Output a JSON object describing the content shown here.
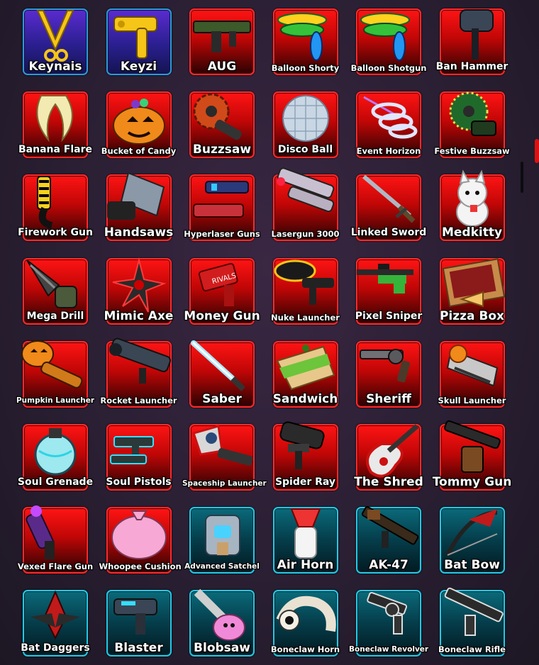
{
  "inventory": {
    "items": [
      {
        "name": "Keynais",
        "rarity": "blue",
        "icon": "golden-crossed-blades-icon"
      },
      {
        "name": "Keyzi",
        "rarity": "blue",
        "icon": "golden-key-gun-icon"
      },
      {
        "name": "AUG",
        "rarity": "red",
        "icon": "green-rifle-icon"
      },
      {
        "name": "Balloon Shorty",
        "rarity": "red",
        "icon": "balloon-shotgun-icon"
      },
      {
        "name": "Balloon Shotgun",
        "rarity": "red",
        "icon": "balloon-shotgun-icon"
      },
      {
        "name": "Ban Hammer",
        "rarity": "red",
        "icon": "hammer-icon"
      },
      {
        "name": "Banana Flare",
        "rarity": "red",
        "icon": "banana-icon"
      },
      {
        "name": "Bucket of Candy",
        "rarity": "red",
        "icon": "pumpkin-bucket-icon"
      },
      {
        "name": "Buzzsaw",
        "rarity": "red",
        "icon": "buzzsaw-icon"
      },
      {
        "name": "Disco Ball",
        "rarity": "red",
        "icon": "disco-ball-icon"
      },
      {
        "name": "Event Horizon",
        "rarity": "red",
        "icon": "spiral-gun-icon"
      },
      {
        "name": "Festive Buzzsaw",
        "rarity": "red",
        "icon": "festive-buzzsaw-icon"
      },
      {
        "name": "Firework Gun",
        "rarity": "red",
        "icon": "firework-gun-icon"
      },
      {
        "name": "Handsaws",
        "rarity": "red",
        "icon": "handsaw-icon"
      },
      {
        "name": "Hyperlaser Guns",
        "rarity": "red",
        "icon": "laser-pistols-icon"
      },
      {
        "name": "Lasergun 3000",
        "rarity": "red",
        "icon": "lasergun-icon"
      },
      {
        "name": "Linked Sword",
        "rarity": "red",
        "icon": "sword-icon"
      },
      {
        "name": "Medkitty",
        "rarity": "red",
        "icon": "cat-icon"
      },
      {
        "name": "Mega Drill",
        "rarity": "red",
        "icon": "drill-icon"
      },
      {
        "name": "Mimic Axe",
        "rarity": "red",
        "icon": "shuriken-axe-icon"
      },
      {
        "name": "Money Gun",
        "rarity": "red",
        "icon": "money-gun-icon"
      },
      {
        "name": "Nuke Launcher",
        "rarity": "red",
        "icon": "nuke-launcher-icon"
      },
      {
        "name": "Pixel Sniper",
        "rarity": "red",
        "icon": "pixel-sniper-icon"
      },
      {
        "name": "Pizza Box",
        "rarity": "red",
        "icon": "pizza-box-icon"
      },
      {
        "name": "Pumpkin Launcher",
        "rarity": "red",
        "icon": "pumpkin-launcher-icon"
      },
      {
        "name": "Rocket Launcher",
        "rarity": "red",
        "icon": "rocket-launcher-icon"
      },
      {
        "name": "Saber",
        "rarity": "red",
        "icon": "light-saber-icon"
      },
      {
        "name": "Sandwich",
        "rarity": "red",
        "icon": "sandwich-icon"
      },
      {
        "name": "Sheriff",
        "rarity": "red",
        "icon": "revolver-icon"
      },
      {
        "name": "Skull Launcher",
        "rarity": "red",
        "icon": "skull-launcher-icon"
      },
      {
        "name": "Soul Grenade",
        "rarity": "red",
        "icon": "grenade-icon"
      },
      {
        "name": "Soul Pistols",
        "rarity": "red",
        "icon": "soul-pistols-icon"
      },
      {
        "name": "Spaceship Launcher",
        "rarity": "red",
        "icon": "spaceship-launcher-icon"
      },
      {
        "name": "Spider Ray",
        "rarity": "red",
        "icon": "spider-ray-icon"
      },
      {
        "name": "The Shred",
        "rarity": "red",
        "icon": "guitar-icon"
      },
      {
        "name": "Tommy Gun",
        "rarity": "red",
        "icon": "tommy-gun-icon"
      },
      {
        "name": "Vexed Flare Gun",
        "rarity": "red",
        "icon": "flare-gun-icon"
      },
      {
        "name": "Whoopee Cushion",
        "rarity": "red",
        "icon": "whoopee-cushion-icon"
      },
      {
        "name": "Advanced Satchel",
        "rarity": "cyan",
        "icon": "satchel-icon"
      },
      {
        "name": "Air Horn",
        "rarity": "cyan",
        "icon": "air-horn-icon"
      },
      {
        "name": "AK-47",
        "rarity": "cyan",
        "icon": "ak47-icon"
      },
      {
        "name": "Bat Bow",
        "rarity": "cyan",
        "icon": "bat-bow-icon"
      },
      {
        "name": "Bat Daggers",
        "rarity": "cyan",
        "icon": "bat-daggers-icon"
      },
      {
        "name": "Blaster",
        "rarity": "cyan",
        "icon": "blaster-icon"
      },
      {
        "name": "Blobsaw",
        "rarity": "cyan",
        "icon": "blobsaw-icon"
      },
      {
        "name": "Boneclaw Horn",
        "rarity": "cyan",
        "icon": "bone-horn-icon"
      },
      {
        "name": "Boneclaw Revolver",
        "rarity": "cyan",
        "icon": "bone-revolver-icon"
      },
      {
        "name": "Boneclaw Rifle",
        "rarity": "cyan",
        "icon": "bone-rifle-icon"
      }
    ]
  },
  "colors": {
    "red_tile": "#e00808",
    "blue_tile": "#2a1f8f",
    "cyan_tile": "#064a58",
    "label": "#ffffff"
  }
}
